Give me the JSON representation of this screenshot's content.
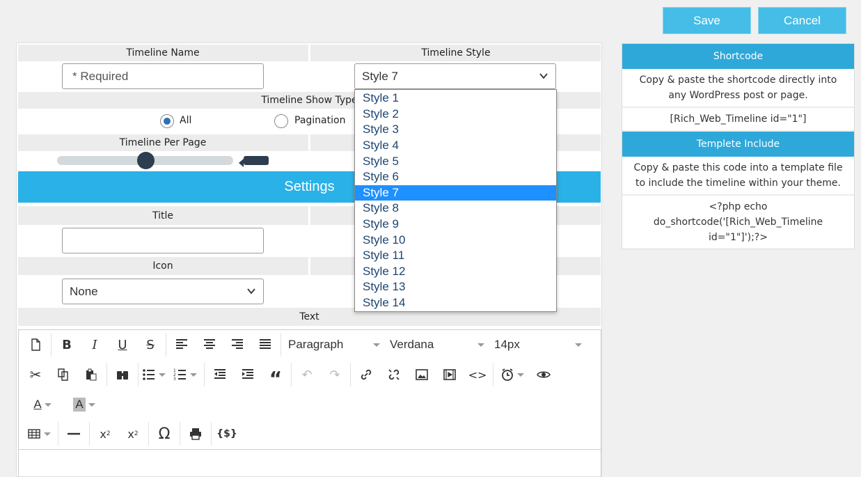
{
  "actions": {
    "save_label": "Save",
    "cancel_label": "Cancel"
  },
  "form": {
    "timeline_name_label": "Timeline Name",
    "timeline_name_placeholder": "* Required",
    "timeline_style_label": "Timeline Style",
    "timeline_style_value": "Style 7",
    "show_type_label": "Timeline Show Type",
    "show_type_options": [
      "All",
      "Pagination"
    ],
    "show_type_selected": "All",
    "per_page_label": "Timeline Per Page",
    "per_page_level": 0.5,
    "settings_label": "Settings",
    "title_label": "Title",
    "title_value": "",
    "icon_label": "Icon",
    "icon_value": "None",
    "text_label": "Text"
  },
  "style_dropdown": {
    "options": [
      "Style 1",
      "Style 2",
      "Style 3",
      "Style 4",
      "Style 5",
      "Style 6",
      "Style 7",
      "Style 8",
      "Style 9",
      "Style 10",
      "Style 11",
      "Style 12",
      "Style 13",
      "Style 14"
    ],
    "selected": "Style 7"
  },
  "editor": {
    "format_value": "Paragraph",
    "font_value": "Verdana",
    "size_value": "14px",
    "icons_row1": [
      "new-document-icon",
      "bold-icon",
      "italic-icon",
      "underline-icon",
      "strikethrough-icon",
      "align-left-icon",
      "align-center-icon",
      "align-right-icon",
      "align-justify-icon"
    ],
    "icons_row2": [
      "cut-icon",
      "copy-icon",
      "paste-icon",
      "find-icon",
      "bullet-list-icon",
      "numbered-list-icon",
      "outdent-icon",
      "indent-icon",
      "blockquote-icon",
      "undo-icon",
      "redo-icon",
      "link-icon",
      "unlink-icon",
      "image-icon",
      "media-icon",
      "code-icon",
      "time-icon",
      "preview-icon"
    ],
    "icons_row3": [
      "text-color-icon",
      "background-color-icon"
    ],
    "icons_row4": [
      "table-icon",
      "horizontal-rule-icon",
      "subscript-icon",
      "superscript-icon",
      "special-character-icon",
      "print-icon",
      "template-icon"
    ]
  },
  "sidebar": {
    "shortcode_title": "Shortcode",
    "shortcode_help": "Copy & paste the shortcode directly into any WordPress post or page.",
    "shortcode_code": "[Rich_Web_Timeline id=\"1\"]",
    "template_title": "Templete Include",
    "template_help": "Copy & paste this code into a template file to include the timeline within your theme.",
    "template_code": "<?php echo do_shortcode('[Rich_Web_Timeline id=\"1\"]');?>"
  }
}
